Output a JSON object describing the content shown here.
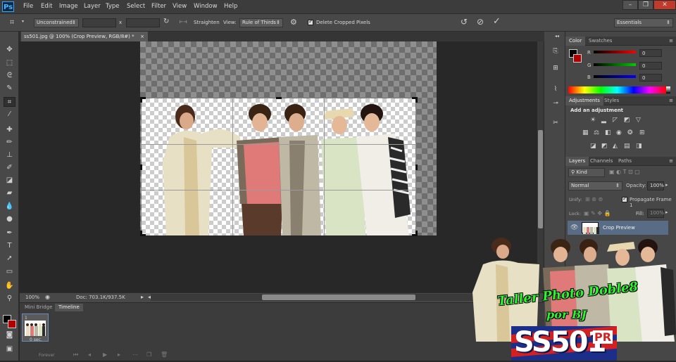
{
  "app": {
    "logo": "Ps"
  },
  "menu": [
    "File",
    "Edit",
    "Image",
    "Layer",
    "Type",
    "Select",
    "Filter",
    "View",
    "Window",
    "Help"
  ],
  "window_controls": {
    "minimize": "–",
    "restore": "❐",
    "close": "✕"
  },
  "options": {
    "ratio": "Unconstrained",
    "width_value": "",
    "x_sep": "x",
    "height_value": "",
    "straighten_label": "Straighten",
    "view_label": "View:",
    "view_value": "Rule of Thirds",
    "delete_cropped": "Delete Cropped Pixels",
    "delete_cropped_checked": true,
    "workspace": "Essentials"
  },
  "document": {
    "tab_title": "ss501.jpg @ 100% (Crop Preview, RGB/8#) *",
    "tab_close": "×"
  },
  "status": {
    "zoom": "100%",
    "doc": "Doc: 703.1K/937.5K"
  },
  "bottom_panel": {
    "tabs": [
      "Mini Bridge",
      "Timeline"
    ],
    "frame_number": "1",
    "frame_delay": "0 sec.",
    "loop": "Forever"
  },
  "color_panel": {
    "tabs": [
      "Color",
      "Swatches"
    ],
    "channels": [
      {
        "label": "R",
        "value": "0"
      },
      {
        "label": "G",
        "value": "0"
      },
      {
        "label": "B",
        "value": "0"
      }
    ]
  },
  "adjustments": {
    "tabs": [
      "Adjustments",
      "Styles"
    ],
    "heading": "Add an adjustment"
  },
  "layers": {
    "tabs": [
      "Layers",
      "Channels",
      "Paths"
    ],
    "filter": "Kind",
    "blend_mode": "Normal",
    "opacity_label": "Opacity:",
    "opacity_value": "100%",
    "unify_label": "Unify:",
    "propagate_label": "Propagate Frame 1",
    "lock_label": "Lock:",
    "fill_label": "Fill:",
    "fill_value": "100%",
    "layer_name": "Crop Preview"
  },
  "watermark": {
    "line1": "Taller Photo Doble8",
    "line2": "por BJ",
    "logo": "SS501",
    "logo_suffix": "PR"
  },
  "colors": {
    "fg": "#000000",
    "bg": "#b00000",
    "accent": "#31a8ff",
    "selection": "#596c86"
  }
}
